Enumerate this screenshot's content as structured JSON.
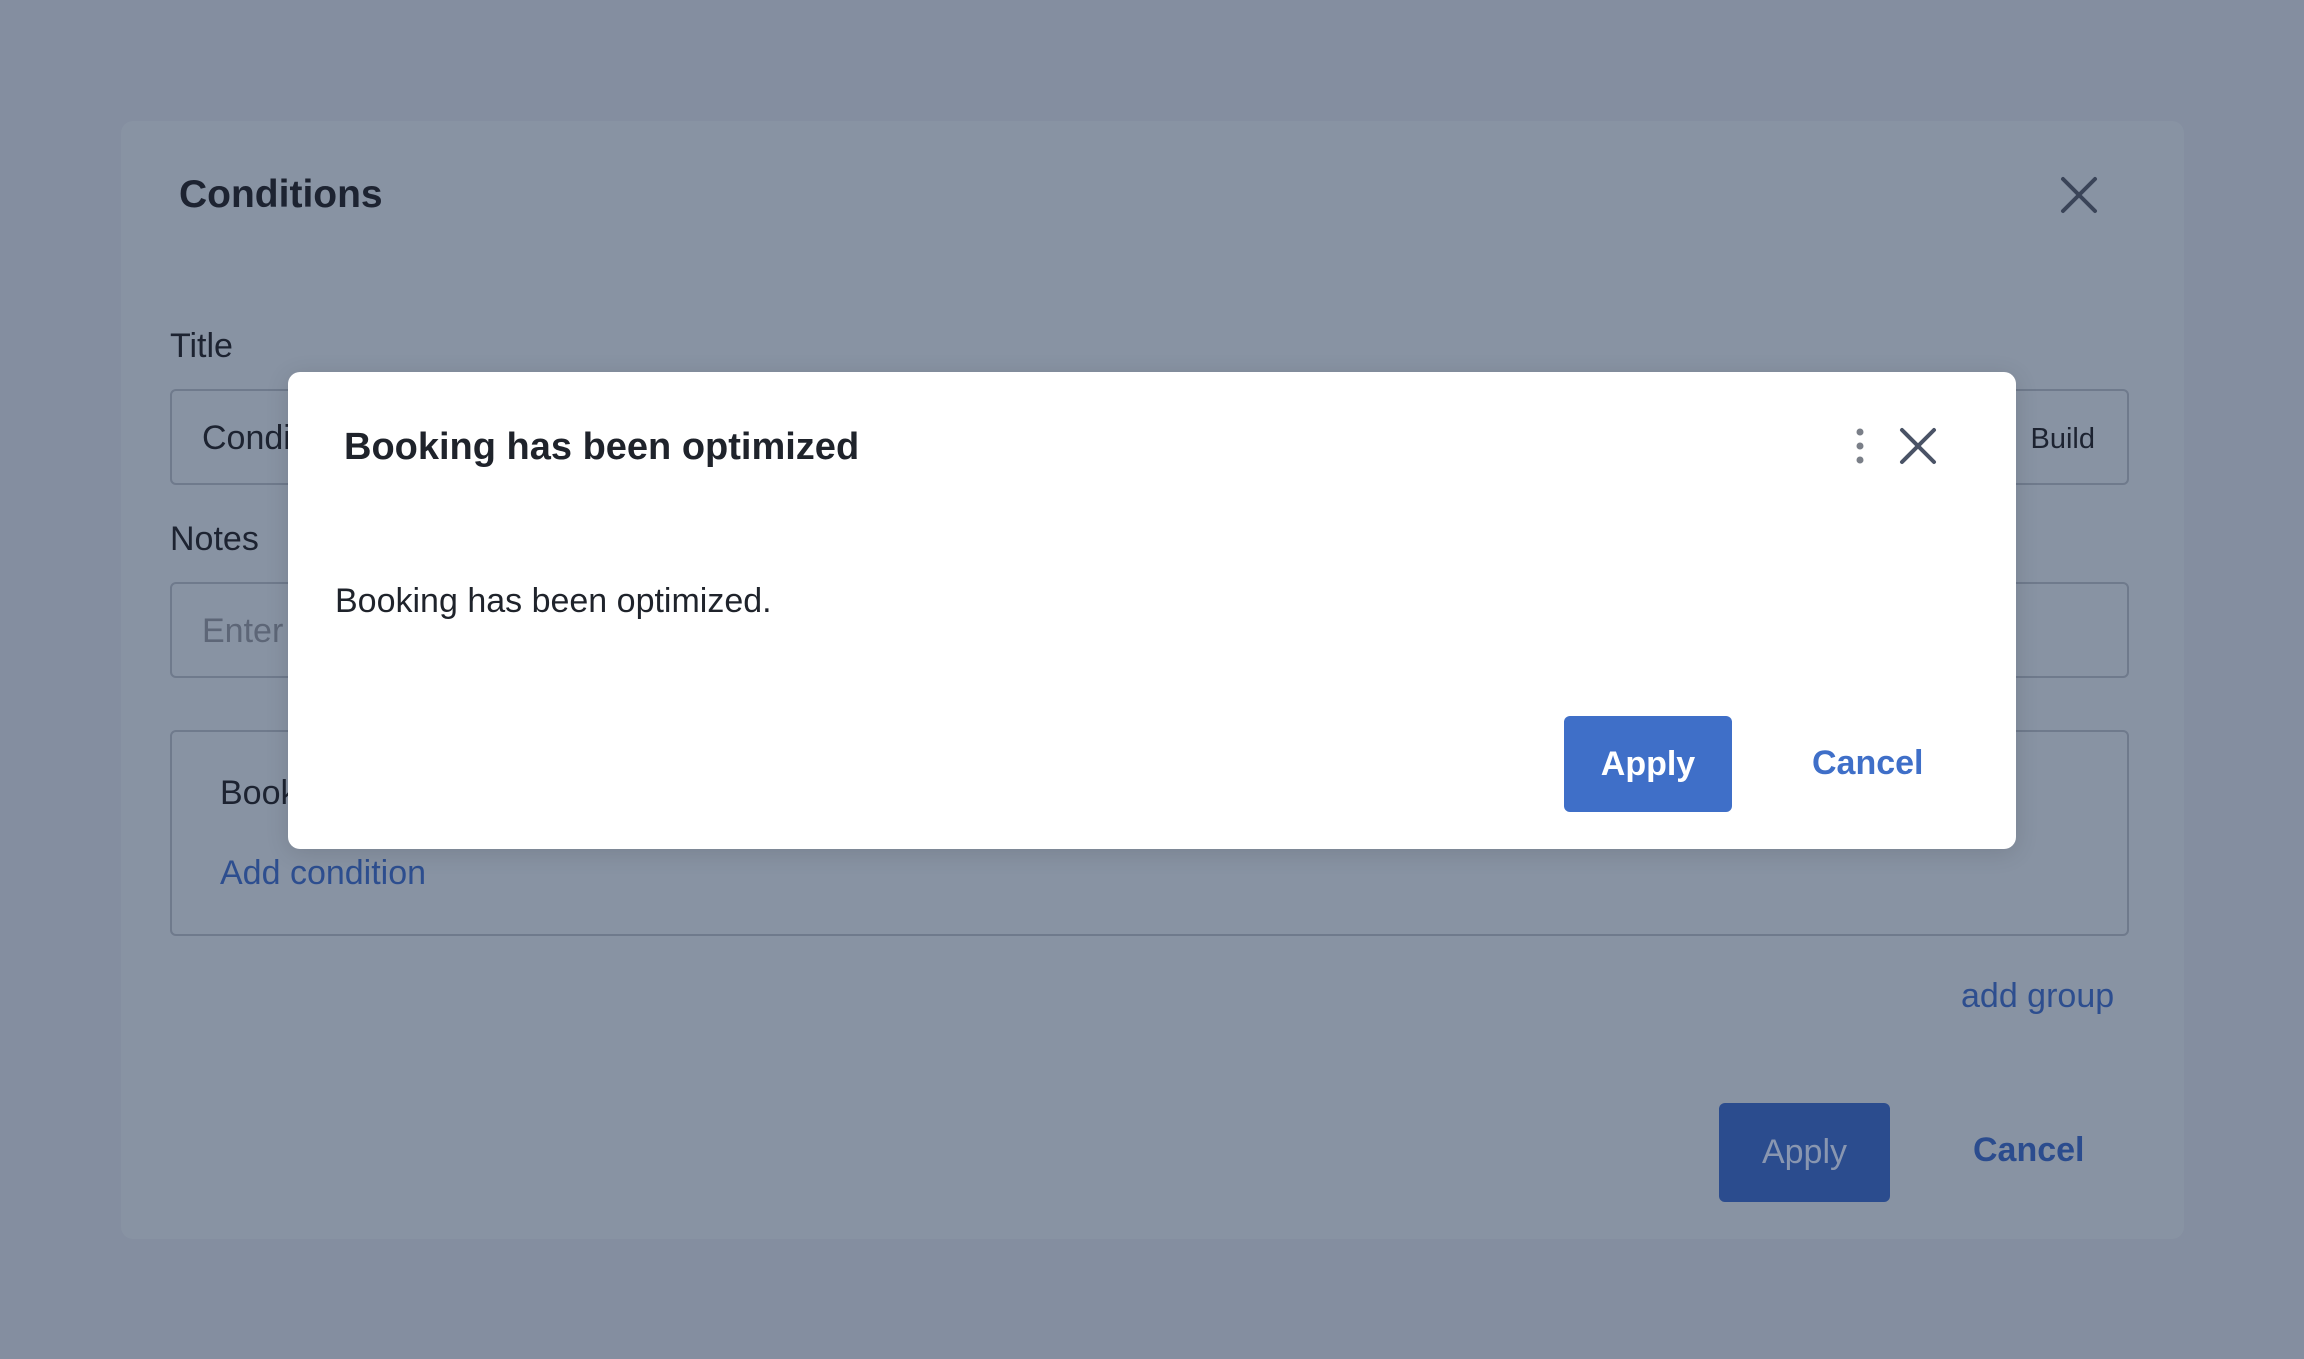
{
  "background_dialog": {
    "title": "Conditions",
    "close_icon": "close-icon",
    "title_field": {
      "label": "Title",
      "value": "Condi",
      "build_label": "Build"
    },
    "notes_field": {
      "label": "Notes",
      "placeholder": "Enter"
    },
    "condition_group": {
      "label": "Book",
      "add_condition_label": "Add condition"
    },
    "add_group_label": "add group",
    "apply_label": "Apply",
    "cancel_label": "Cancel"
  },
  "modal": {
    "title": "Booking has been optimized",
    "more_icon": "more-vertical-icon",
    "close_icon": "close-icon",
    "message": "Booking has been optimized.",
    "apply_label": "Apply",
    "cancel_label": "Cancel"
  },
  "colors": {
    "overlay": "#848ea0",
    "primary": "#3f6fc8",
    "primary_dimmed": "#2b4c8e"
  }
}
